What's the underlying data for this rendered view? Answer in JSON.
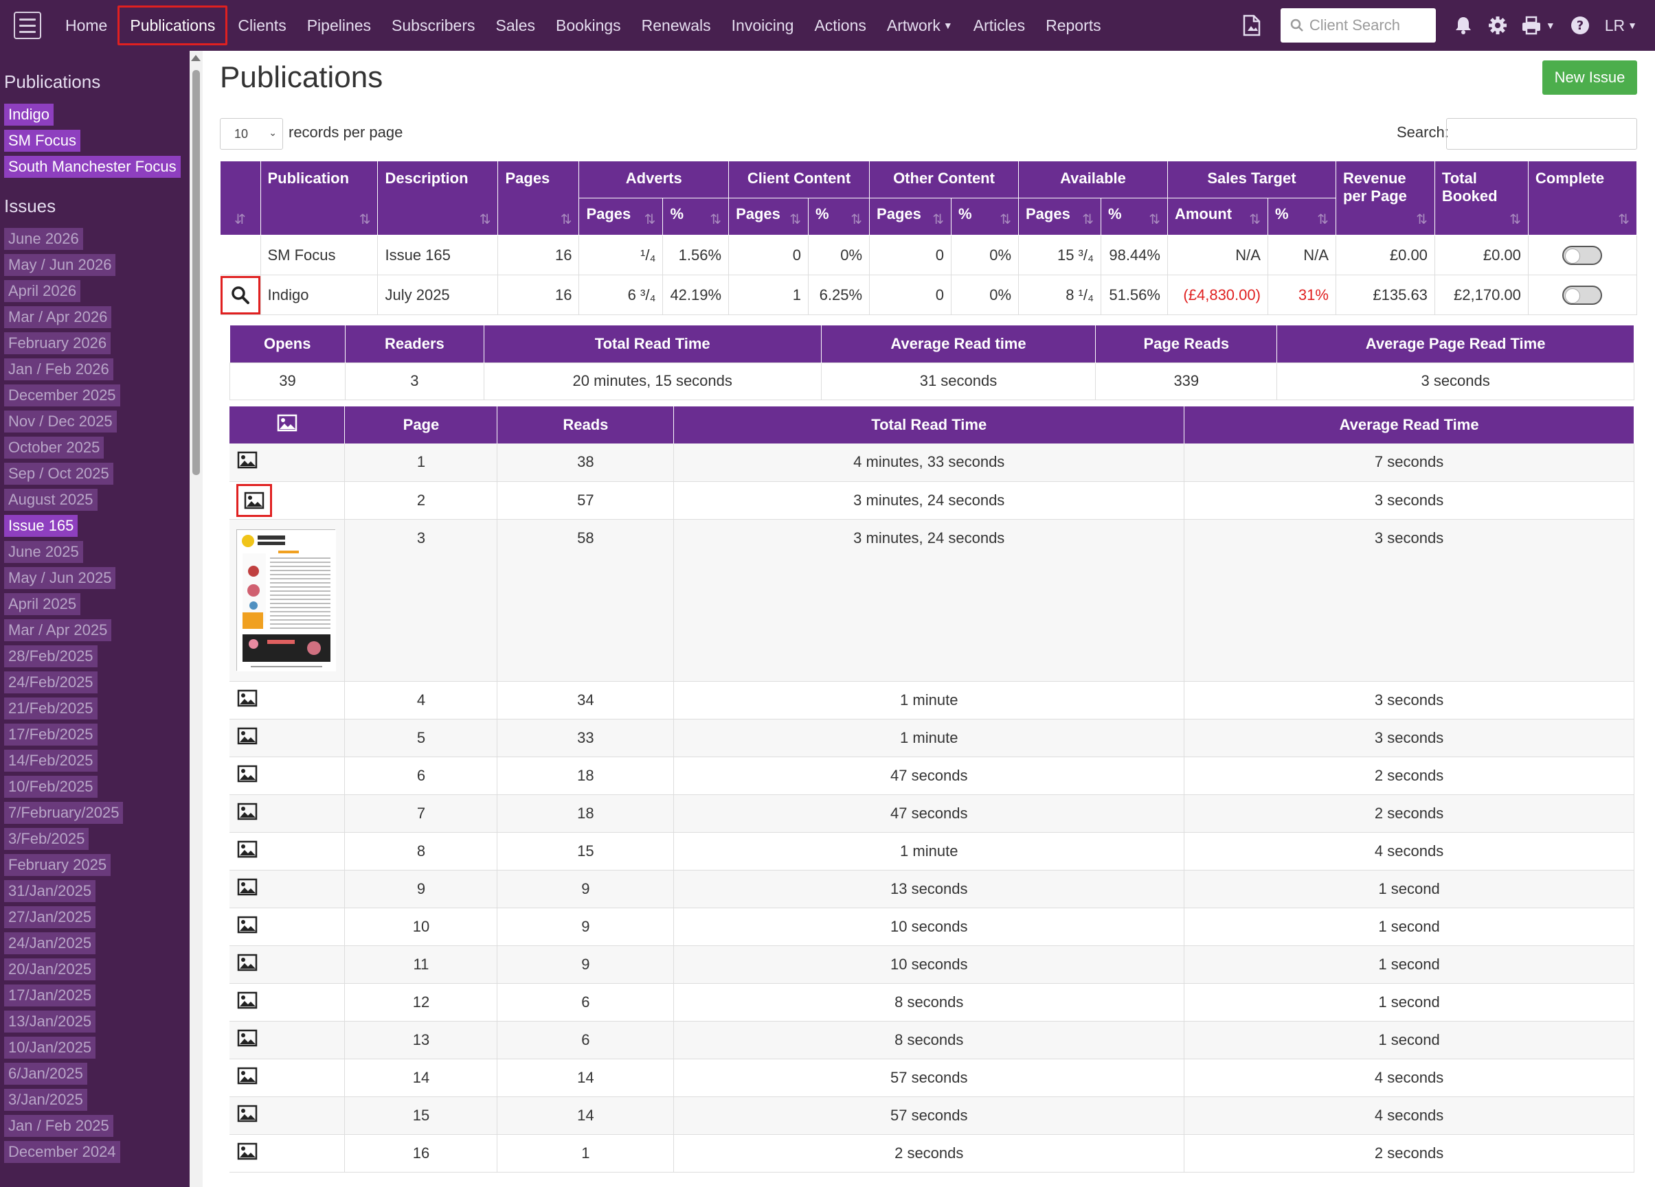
{
  "nav": {
    "items": [
      "Home",
      "Publications",
      "Clients",
      "Pipelines",
      "Subscribers",
      "Sales",
      "Bookings",
      "Renewals",
      "Invoicing",
      "Actions",
      "Artwork",
      "Articles",
      "Reports"
    ],
    "active": "Publications",
    "search_placeholder": "Client Search",
    "user_initials": "LR"
  },
  "sidebar": {
    "publications_heading": "Publications",
    "publications": [
      "Indigo",
      "SM Focus",
      "South Manchester Focus"
    ],
    "issues_heading": "Issues",
    "issues": [
      "June 2026",
      "May / Jun 2026",
      "April 2026",
      "Mar / Apr 2026",
      "February 2026",
      "Jan / Feb 2026",
      "December 2025",
      "Nov / Dec 2025",
      "October 2025",
      "Sep / Oct 2025",
      "August 2025",
      "Issue 165",
      "June 2025",
      "May / Jun 2025",
      "April 2025",
      "Mar / Apr 2025",
      "28/Feb/2025",
      "24/Feb/2025",
      "21/Feb/2025",
      "17/Feb/2025",
      "14/Feb/2025",
      "10/Feb/2025",
      "7/February/2025",
      "3/Feb/2025",
      "February 2025",
      "31/Jan/2025",
      "27/Jan/2025",
      "24/Jan/2025",
      "20/Jan/2025",
      "17/Jan/2025",
      "13/Jan/2025",
      "10/Jan/2025",
      "6/Jan/2025",
      "3/Jan/2025",
      "Jan / Feb 2025",
      "December 2024"
    ],
    "active_issue": "Issue 165"
  },
  "main": {
    "title": "Publications",
    "new_issue_label": "New Issue",
    "records_per_page_value": "10",
    "records_per_page_label": "records per page",
    "search_label": "Search:"
  },
  "pub_table": {
    "headers": {
      "publication": "Publication",
      "description": "Description",
      "pages": "Pages",
      "adverts": "Adverts",
      "client_content": "Client Content",
      "other_content": "Other Content",
      "available": "Available",
      "sales_target": "Sales Target",
      "revenue_per_page": "Revenue per Page",
      "total_booked": "Total Booked",
      "complete": "Complete",
      "sub_pages": "Pages",
      "sub_pct": "%",
      "sub_amount": "Amount"
    },
    "rows": [
      {
        "publication": "SM Focus",
        "description": "Issue 165",
        "pages": "16",
        "adv_pages": "¹/₄",
        "adv_pct": "1.56%",
        "cc_pages": "0",
        "cc_pct": "0%",
        "oc_pages": "0",
        "oc_pct": "0%",
        "av_pages": "15 ³/₄",
        "av_pct": "98.44%",
        "st_amount": "N/A",
        "st_pct": "N/A",
        "rev_per_page": "£0.00",
        "total_booked": "£0.00",
        "complete": false
      },
      {
        "publication": "Indigo",
        "description": "July 2025",
        "pages": "16",
        "adv_pages": "6 ³/₄",
        "adv_pct": "42.19%",
        "cc_pages": "1",
        "cc_pct": "6.25%",
        "oc_pages": "0",
        "oc_pct": "0%",
        "av_pages": "8 ¹/₄",
        "av_pct": "51.56%",
        "st_amount": "(£4,830.00)",
        "st_pct": "31%",
        "rev_per_page": "£135.63",
        "total_booked": "£2,170.00",
        "complete": false
      }
    ]
  },
  "stats": {
    "headers": [
      "Opens",
      "Readers",
      "Total Read Time",
      "Average Read time",
      "Page Reads",
      "Average Page Read Time"
    ],
    "values": [
      "39",
      "3",
      "20 minutes, 15 seconds",
      "31 seconds",
      "339",
      "3 seconds"
    ]
  },
  "page_reads": {
    "headers": [
      "Page",
      "Reads",
      "Total Read Time",
      "Average Read Time"
    ],
    "rows": [
      {
        "page": "1",
        "reads": "38",
        "total": "4 minutes, 33 seconds",
        "avg": "7 seconds"
      },
      {
        "page": "2",
        "reads": "57",
        "total": "3 minutes, 24 seconds",
        "avg": "3 seconds"
      },
      {
        "page": "3",
        "reads": "58",
        "total": "3 minutes, 24 seconds",
        "avg": "3 seconds"
      },
      {
        "page": "4",
        "reads": "34",
        "total": "1 minute",
        "avg": "3 seconds"
      },
      {
        "page": "5",
        "reads": "33",
        "total": "1 minute",
        "avg": "3 seconds"
      },
      {
        "page": "6",
        "reads": "18",
        "total": "47 seconds",
        "avg": "2 seconds"
      },
      {
        "page": "7",
        "reads": "18",
        "total": "47 seconds",
        "avg": "2 seconds"
      },
      {
        "page": "8",
        "reads": "15",
        "total": "1 minute",
        "avg": "4 seconds"
      },
      {
        "page": "9",
        "reads": "9",
        "total": "13 seconds",
        "avg": "1 second"
      },
      {
        "page": "10",
        "reads": "9",
        "total": "10 seconds",
        "avg": "1 second"
      },
      {
        "page": "11",
        "reads": "9",
        "total": "10 seconds",
        "avg": "1 second"
      },
      {
        "page": "12",
        "reads": "6",
        "total": "8 seconds",
        "avg": "1 second"
      },
      {
        "page": "13",
        "reads": "6",
        "total": "8 seconds",
        "avg": "1 second"
      },
      {
        "page": "14",
        "reads": "14",
        "total": "57 seconds",
        "avg": "4 seconds"
      },
      {
        "page": "15",
        "reads": "14",
        "total": "57 seconds",
        "avg": "4 seconds"
      },
      {
        "page": "16",
        "reads": "1",
        "total": "2 seconds",
        "avg": "2 seconds"
      }
    ],
    "thumbnail_row_index": 2
  },
  "colors": {
    "nav_bg": "#47204f",
    "header_purple": "#6a2d91",
    "pub_tag": "#8e3fbf",
    "issue_tag": "#6a3a7c",
    "new_button": "#4cae4c",
    "highlight": "#e02020",
    "negative": "#e02020"
  },
  "icons": {
    "menu": "hamburger-icon",
    "pdf": "document-icon",
    "search": "search-icon",
    "notifications": "bell-icon",
    "settings": "gear-icon",
    "print": "printer-icon",
    "help": "question-circle-icon",
    "row_image": "image-icon",
    "expand": "magnifier-icon",
    "sort": "sort-arrows-icon"
  }
}
